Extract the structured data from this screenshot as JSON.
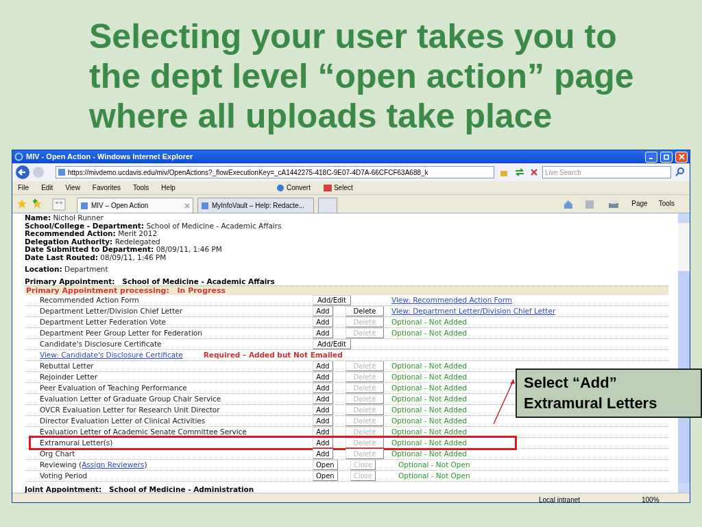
{
  "slide": {
    "title": "Selecting your user takes you to the dept level “open action” page where all uploads take place",
    "callout": "Select “Add” Extramural Letters"
  },
  "browser": {
    "title": "MIV - Open Action - Windows Internet Explorer",
    "url": "https://mivdemo.ucdavis.edu/miv/OpenActions?_flowExecutionKey=_cA1442275-418C-9E07-4D7A-66CFCF63A688_k",
    "search_placeholder": "Live Search",
    "menu": [
      "File",
      "Edit",
      "View",
      "Favorites",
      "Tools",
      "Help"
    ],
    "toolbar": [
      "Convert",
      "Select"
    ],
    "tabs": [
      {
        "label": "MIV – Open Action",
        "selected": true
      },
      {
        "label": "MyInfoVault – Help: Redacte...",
        "selected": false
      }
    ],
    "commands": [
      "Page",
      "Tools"
    ],
    "status": [
      "Local intranet",
      "100%"
    ]
  },
  "details": [
    {
      "label": "Name:",
      "value": "Nichol Runner"
    },
    {
      "label": "School/College - Department:",
      "value": "School of Medicine - Academic Affairs"
    },
    {
      "label": "Recommended Action:",
      "value": "Merit 2012"
    },
    {
      "label": "Delegation Authority:",
      "value": "Redelegated"
    },
    {
      "label": "Date Submitted to Department:",
      "value": "08/09/11, 1:46 PM"
    },
    {
      "label": "Date Last Routed:",
      "value": "08/09/11, 1:46 PM"
    }
  ],
  "location": {
    "label": "Location:",
    "value": "Department"
  },
  "appointment": "Primary Appointment:   School of Medicine - Academic Affairs",
  "processing": "Primary Appointment processing:   In Progress",
  "rows": [
    {
      "kind": "item",
      "highlighted": false,
      "label": "Recommended Action Form",
      "buttons": [
        {
          "label": "Add/Edit",
          "disabled": false
        }
      ],
      "status": {
        "kind": "link",
        "text": "View: Recommended Action Form"
      }
    },
    {
      "kind": "item",
      "highlighted": false,
      "label": "Department Letter/Division Chief Letter",
      "buttons": [
        {
          "label": "Add",
          "disabled": false
        },
        {
          "label": "Delete",
          "disabled": false
        }
      ],
      "status": {
        "kind": "link",
        "text": "View: Department Letter/Division Chief Letter"
      }
    },
    {
      "kind": "item",
      "highlighted": false,
      "label": "Department Letter Federation Vote",
      "buttons": [
        {
          "label": "Add",
          "disabled": false
        },
        {
          "label": "Delete",
          "disabled": true
        }
      ],
      "status": {
        "kind": "optional",
        "text": "Optional - Not Added"
      }
    },
    {
      "kind": "item",
      "highlighted": false,
      "label": "Department Peer Group Letter for Federation",
      "buttons": [
        {
          "label": "Add",
          "disabled": false
        },
        {
          "label": "Delete",
          "disabled": true
        }
      ],
      "status": {
        "kind": "optional",
        "text": "Optional - Not Added"
      }
    },
    {
      "kind": "item",
      "highlighted": false,
      "label": "Candidate's Disclosure Certificate",
      "buttons": [
        {
          "label": "Add/Edit",
          "disabled": false
        }
      ]
    },
    {
      "kind": "note",
      "highlighted": false,
      "link": "View: Candidate's Disclosure Certificate",
      "note": "Required – Added but Not Emailed"
    },
    {
      "kind": "item",
      "highlighted": false,
      "label": "Rebuttal Letter",
      "buttons": [
        {
          "label": "Add",
          "disabled": false
        },
        {
          "label": "Delete",
          "disabled": true
        }
      ],
      "status": {
        "kind": "optional",
        "text": "Optional - Not Added"
      }
    },
    {
      "kind": "item",
      "highlighted": false,
      "label": "Rejoinder Letter",
      "buttons": [
        {
          "label": "Add",
          "disabled": false
        },
        {
          "label": "Delete",
          "disabled": true
        }
      ],
      "status": {
        "kind": "optional",
        "text": "Optional - Not Added"
      }
    },
    {
      "kind": "item",
      "highlighted": false,
      "label": "Peer Evaluation of Teaching Performance",
      "buttons": [
        {
          "label": "Add",
          "disabled": false
        },
        {
          "label": "Delete",
          "disabled": true
        }
      ],
      "status": {
        "kind": "optional",
        "text": "Optional - Not Added"
      }
    },
    {
      "kind": "item",
      "highlighted": false,
      "label": "Evaluation Letter of Graduate Group Chair Service",
      "buttons": [
        {
          "label": "Add",
          "disabled": false
        },
        {
          "label": "Delete",
          "disabled": true
        }
      ],
      "status": {
        "kind": "optional",
        "text": "Optional - Not Added"
      }
    },
    {
      "kind": "item",
      "highlighted": false,
      "label": "OVCR Evaluation Letter for Research Unit Director",
      "buttons": [
        {
          "label": "Add",
          "disabled": false
        },
        {
          "label": "Delete",
          "disabled": true
        }
      ],
      "status": {
        "kind": "optional",
        "text": "Optional - Not Added"
      }
    },
    {
      "kind": "item",
      "highlighted": false,
      "label": "Director Evaluation Letter of Clinical Activities",
      "buttons": [
        {
          "label": "Add",
          "disabled": false
        },
        {
          "label": "Delete",
          "disabled": true
        }
      ],
      "status": {
        "kind": "optional",
        "text": "Optional - Not Added"
      }
    },
    {
      "kind": "item",
      "highlighted": false,
      "label": "Evaluation Letter of Academic Senate Committee Service",
      "buttons": [
        {
          "label": "Add",
          "disabled": false
        },
        {
          "label": "Delete",
          "disabled": true
        }
      ],
      "status": {
        "kind": "optional",
        "text": "Optional - Not Added"
      }
    },
    {
      "kind": "item",
      "highlighted": true,
      "label": "Extramural Letter(s)",
      "buttons": [
        {
          "label": "Add",
          "disabled": false
        },
        {
          "label": "Delete",
          "disabled": true
        }
      ],
      "status": {
        "kind": "optional",
        "text": "Optional - Not Added"
      }
    },
    {
      "kind": "item",
      "highlighted": false,
      "label": "Org Chart",
      "buttons": [
        {
          "label": "Add",
          "disabled": false
        },
        {
          "label": "Delete",
          "disabled": true
        }
      ],
      "status": {
        "kind": "optional",
        "text": "Optional - Not Added"
      }
    },
    {
      "kind": "item",
      "highlighted": false,
      "label": "Reviewing (",
      "label_link": "Assign Reviewers",
      "label_suffix": ")",
      "buttons": [
        {
          "label": "Open",
          "disabled": false
        },
        {
          "label": "Close",
          "disabled": true
        }
      ],
      "status": {
        "kind": "optional",
        "text": "Optional - Not Open"
      }
    },
    {
      "kind": "item",
      "highlighted": false,
      "label": "Voting Period",
      "buttons": [
        {
          "label": "Open",
          "disabled": false
        },
        {
          "label": "Close",
          "disabled": true
        }
      ],
      "status": {
        "kind": "optional",
        "text": "Optional - Not Open"
      }
    }
  ],
  "joint": "Joint Appointment:   School of Medicine - Administration"
}
